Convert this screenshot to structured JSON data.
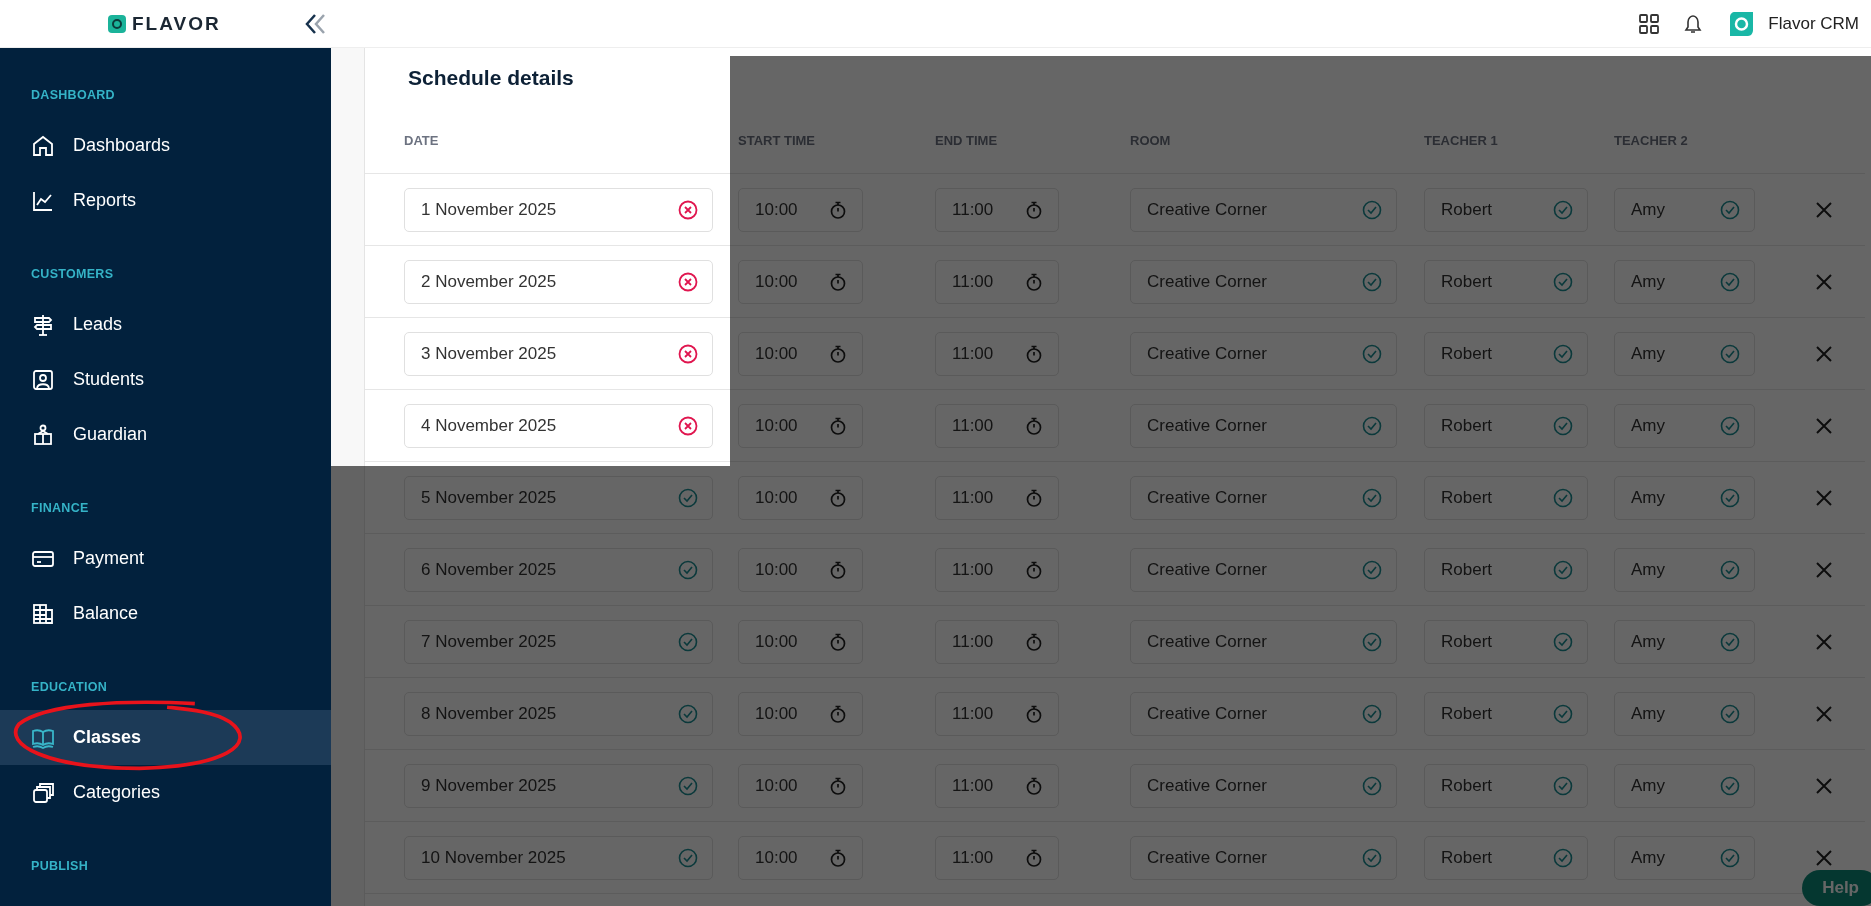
{
  "header": {
    "logo_text": "FLAVOR",
    "account_name": "Flavor CRM"
  },
  "sidebar": {
    "sections": [
      {
        "label": "DASHBOARD",
        "items": [
          {
            "label": "Dashboards",
            "selected": false
          },
          {
            "label": "Reports",
            "selected": false
          }
        ]
      },
      {
        "label": "CUSTOMERS",
        "items": [
          {
            "label": "Leads",
            "selected": false
          },
          {
            "label": "Students",
            "selected": false
          },
          {
            "label": "Guardian",
            "selected": false
          }
        ]
      },
      {
        "label": "FINANCE",
        "items": [
          {
            "label": "Payment",
            "selected": false
          },
          {
            "label": "Balance",
            "selected": false
          }
        ]
      },
      {
        "label": "EDUCATION",
        "items": [
          {
            "label": "Classes",
            "selected": true
          },
          {
            "label": "Categories",
            "selected": false
          }
        ]
      },
      {
        "label": "PUBLISH"
      }
    ]
  },
  "schedule": {
    "title": "Schedule details",
    "columns": [
      "DATE",
      "START TIME",
      "END TIME",
      "ROOM",
      "TEACHER 1",
      "TEACHER 2"
    ],
    "rows": [
      {
        "date": "1 November 2025",
        "date_valid": false,
        "start_time": "10:00",
        "end_time": "11:00",
        "room": "Creative Corner",
        "teacher_1": "Robert",
        "teacher_2": "Amy"
      },
      {
        "date": "2 November 2025",
        "date_valid": false,
        "start_time": "10:00",
        "end_time": "11:00",
        "room": "Creative Corner",
        "teacher_1": "Robert",
        "teacher_2": "Amy"
      },
      {
        "date": "3 November 2025",
        "date_valid": false,
        "start_time": "10:00",
        "end_time": "11:00",
        "room": "Creative Corner",
        "teacher_1": "Robert",
        "teacher_2": "Amy"
      },
      {
        "date": "4 November 2025",
        "date_valid": false,
        "start_time": "10:00",
        "end_time": "11:00",
        "room": "Creative Corner",
        "teacher_1": "Robert",
        "teacher_2": "Amy"
      },
      {
        "date": "5 November 2025",
        "date_valid": true,
        "start_time": "10:00",
        "end_time": "11:00",
        "room": "Creative Corner",
        "teacher_1": "Robert",
        "teacher_2": "Amy"
      },
      {
        "date": "6 November 2025",
        "date_valid": true,
        "start_time": "10:00",
        "end_time": "11:00",
        "room": "Creative Corner",
        "teacher_1": "Robert",
        "teacher_2": "Amy"
      },
      {
        "date": "7 November 2025",
        "date_valid": true,
        "start_time": "10:00",
        "end_time": "11:00",
        "room": "Creative Corner",
        "teacher_1": "Robert",
        "teacher_2": "Amy"
      },
      {
        "date": "8 November 2025",
        "date_valid": true,
        "start_time": "10:00",
        "end_time": "11:00",
        "room": "Creative Corner",
        "teacher_1": "Robert",
        "teacher_2": "Amy"
      },
      {
        "date": "9 November 2025",
        "date_valid": true,
        "start_time": "10:00",
        "end_time": "11:00",
        "room": "Creative Corner",
        "teacher_1": "Robert",
        "teacher_2": "Amy"
      },
      {
        "date": "10 November 2025",
        "date_valid": true,
        "start_time": "10:00",
        "end_time": "11:00",
        "room": "Creative Corner",
        "teacher_1": "Robert",
        "teacher_2": "Amy"
      }
    ]
  },
  "help_button": {
    "label": "Help"
  }
}
